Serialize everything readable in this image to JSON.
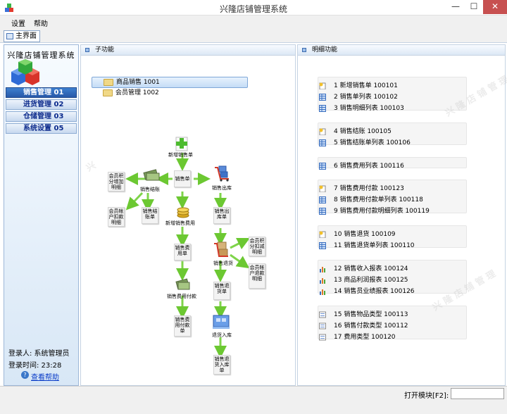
{
  "window": {
    "title": "兴隆店铺管理系统",
    "minimize": "—",
    "maximize": "☐",
    "close": "✕"
  },
  "menu": [
    "设置",
    "帮助"
  ],
  "tab": {
    "main": "主界面"
  },
  "sidebar": {
    "company": "兴隆店铺管理系统",
    "nav": [
      {
        "label": "销售管理 01",
        "active": true
      },
      {
        "label": "进货管理 02",
        "active": false
      },
      {
        "label": "仓储管理 03",
        "active": false
      },
      {
        "label": "系统设置 05",
        "active": false
      }
    ],
    "login_user": "登录人: 系统管理员",
    "login_time": "登录时间: 23:28",
    "help_link": "查看帮助"
  },
  "sub_panel": {
    "title": "子功能",
    "modules": [
      {
        "label": "商品销售  1001",
        "selected": true
      },
      {
        "label": "会员管理  1002",
        "selected": false
      }
    ],
    "flow": {
      "new_sale_order": "新增销售单",
      "sale_order": "销售单",
      "sale_checkout": "销售结账",
      "sale_outbound": "销售出库",
      "member_points_add": "会员积分增加明细",
      "member_account_detail": "会员帐户扣款明细",
      "checkout_order": "销售结账单",
      "new_sale_expense": "新增销售费用",
      "outbound_order": "销售出库单",
      "expense_order": "销售费用单",
      "sale_return": "销售退货",
      "member_points_deduct": "会员积分扣减明细",
      "member_account_refund": "会员帐户退款明细",
      "expense_payment": "销售费用付款",
      "return_order": "销售退货单",
      "expense_payment_order": "销售费用付款单",
      "return_inbound": "退货入库",
      "return_inbound_order": "销售退货入库单"
    }
  },
  "detail_panel": {
    "title": "明细功能",
    "groups": [
      [
        {
          "icon": "new-doc-icon",
          "text": "1  新增销售单  100101"
        },
        {
          "icon": "table-icon",
          "text": "2  销售单列表  100102"
        },
        {
          "icon": "table-icon",
          "text": "3  销售明细列表  100103"
        }
      ],
      [
        {
          "icon": "new-doc-icon",
          "text": "4  销售结账  100105"
        },
        {
          "icon": "table-icon",
          "text": "5  销售结账单列表  100106"
        }
      ],
      [
        {
          "icon": "table-icon",
          "text": "6  销售费用列表  100116"
        }
      ],
      [
        {
          "icon": "new-doc-icon",
          "text": "7  销售费用付款  100123"
        },
        {
          "icon": "table-icon",
          "text": "8  销售费用付款单列表  100118"
        },
        {
          "icon": "table-icon",
          "text": "9  销售费用付款明细列表  100119"
        }
      ],
      [
        {
          "icon": "new-doc-icon",
          "text": "10  销售退货  100109"
        },
        {
          "icon": "table-icon",
          "text": "11  销售退货单列表  100110"
        }
      ],
      [
        {
          "icon": "bar-chart-icon",
          "text": "12  销售收入报表  100124"
        },
        {
          "icon": "bar-chart-icon",
          "text": "13  商品利润报表  100125"
        },
        {
          "icon": "bar-chart-icon",
          "text": "14  销售员业绩报表  100126"
        }
      ],
      [
        {
          "icon": "form-icon",
          "text": "15  销售物品类型  100113"
        },
        {
          "icon": "form-icon",
          "text": "16  销售付款类型  100112"
        },
        {
          "icon": "form-icon",
          "text": "17  费用类型  100120"
        }
      ]
    ]
  },
  "status": {
    "open_module": "打开模块[F2]:",
    "open_input": ""
  },
  "colors": {
    "nav_active": "#2759a8",
    "arrow_green": "#6cc832",
    "close_button": "#c75050",
    "link_blue": "#0a3cc8"
  }
}
